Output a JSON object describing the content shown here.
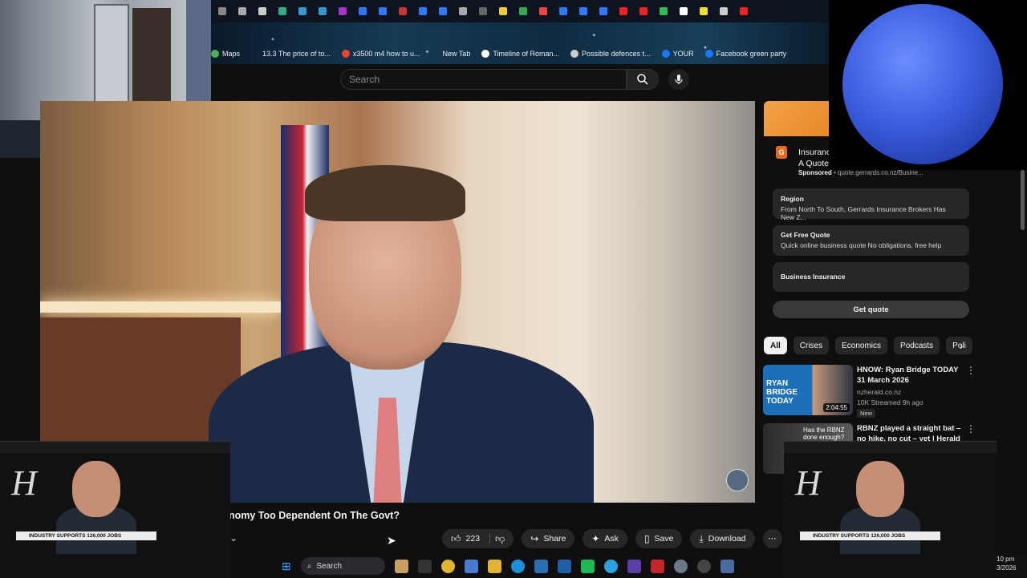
{
  "browser": {
    "tab_icons": [
      "T",
      "(",
      "✕",
      "K",
      "A",
      "P",
      "S",
      "⇨",
      "K",
      "▣",
      "A",
      "P",
      "E",
      "M",
      "M",
      "D",
      "a",
      "P",
      "(",
      "P",
      "(",
      "P",
      "K",
      "C",
      "L",
      "C",
      "▶"
    ],
    "bookmarks": [
      {
        "label": "Maps",
        "color": "#4caf50"
      },
      {
        "label": "13.3 The price of to...",
        "color": "#00000000"
      },
      {
        "label": "x3500 m4 how to u...",
        "color": "#ea4335"
      },
      {
        "label": "New Tab",
        "color": "#00000000"
      },
      {
        "label": "Timeline of Roman...",
        "color": "#ffffff"
      },
      {
        "label": "Possible defences t...",
        "color": "#cccccc"
      },
      {
        "label": "YOUR",
        "color": "#1877f2"
      },
      {
        "label": "Facebook green party",
        "color": "#1877f2"
      }
    ]
  },
  "search": {
    "placeholder": "Search"
  },
  "video": {
    "title": "nomy Too Dependent On The Govt?",
    "likes": "223",
    "actions": {
      "share": "Share",
      "ask": "Ask",
      "save": "Save",
      "download": "Download"
    }
  },
  "ad": {
    "logo_letter": "G",
    "title": "Insurance A Quote",
    "sponsored": "Sponsored",
    "url": "quote.gerrards.co.nz/Busine...",
    "links": [
      {
        "title": "Region",
        "desc": "From North To South, Gerrards Insurance Brokers Has New Z..."
      },
      {
        "title": "Get Free Quote",
        "desc": "Quick online business quote No obligations, free help"
      },
      {
        "title": "Business Insurance",
        "desc": ""
      }
    ],
    "cta": "Get quote"
  },
  "chips": [
    "All",
    "Crises",
    "Economics",
    "Podcasts",
    "Poli"
  ],
  "recommendations": [
    {
      "title": "HNOW: Ryan Bridge TODAY 31 March 2026",
      "channel": "nzherald.co.nz",
      "stats": "10K  Streamed 9h ago",
      "badge": "New",
      "duration": "2:04:55",
      "thumb_text": "RYAN BRIDGE TODAY"
    },
    {
      "title": "RBNZ played a straight bat – no hike, no cut – yet | Herald NO...",
      "channel": "",
      "stats": "",
      "badge": "",
      "duration": "",
      "thumb_text": "Has the RBNZ done enough?"
    }
  ],
  "pip": {
    "banner": "INDUSTRY SUPPORTS 126,000 JOBS",
    "logo": "H"
  },
  "taskbar": {
    "search": "Search"
  },
  "clock": {
    "time": "10 pm",
    "date": "3/2026"
  }
}
